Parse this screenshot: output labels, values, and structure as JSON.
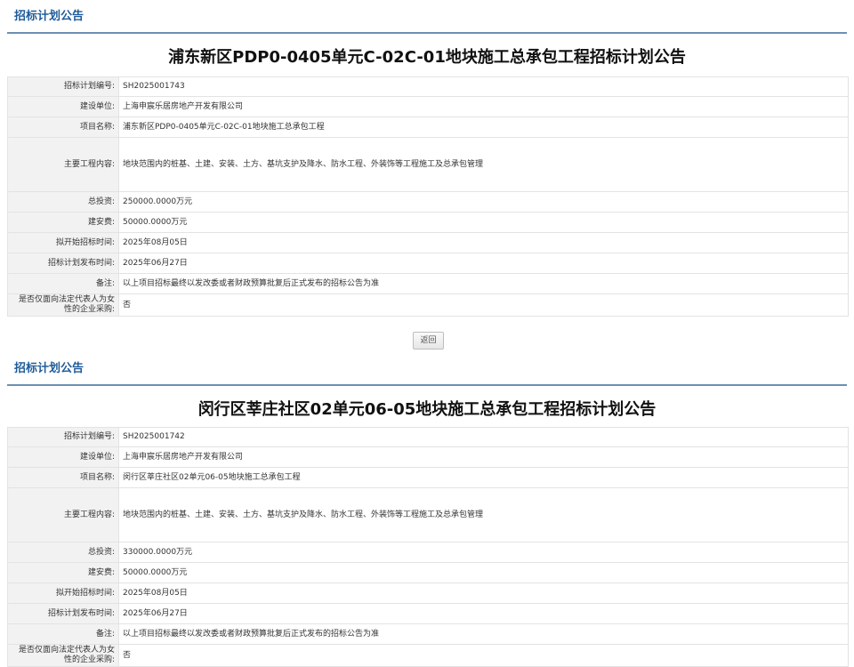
{
  "notices": [
    {
      "section_title": "招标计划公告",
      "title": "浦东新区PDP0-0405单元C-02C-01地块施工总承包工程招标计划公告",
      "rows": [
        {
          "label": "招标计划编号:",
          "value": "SH2025001743"
        },
        {
          "label": "建设单位:",
          "value": "上海申宸乐居房地产开发有限公司"
        },
        {
          "label": "项目名称:",
          "value": "浦东新区PDP0-0405单元C-02C-01地块施工总承包工程"
        },
        {
          "label": "主要工程内容:",
          "value": "地块范围内的桩基、土建、安装、土方、基坑支护及降水、防水工程、外装饰等工程施工及总承包管理"
        },
        {
          "label": "总投资:",
          "value": "250000.0000万元"
        },
        {
          "label": "建安费:",
          "value": "50000.0000万元"
        },
        {
          "label": "拟开始招标时间:",
          "value": "2025年08月05日"
        },
        {
          "label": "招标计划发布时间:",
          "value": "2025年06月27日"
        },
        {
          "label": "备注:",
          "value": "以上项目招标最终以发改委或者财政预算批复后正式发布的招标公告为准"
        },
        {
          "label": "是否仅面向法定代表人为女性的企业采购:",
          "value": "否"
        }
      ],
      "back_label": "返回"
    },
    {
      "section_title": "招标计划公告",
      "title": "闵行区莘庄社区02单元06-05地块施工总承包工程招标计划公告",
      "rows": [
        {
          "label": "招标计划编号:",
          "value": "SH2025001742"
        },
        {
          "label": "建设单位:",
          "value": "上海申宸乐居房地产开发有限公司"
        },
        {
          "label": "项目名称:",
          "value": "闵行区莘庄社区02单元06-05地块施工总承包工程"
        },
        {
          "label": "主要工程内容:",
          "value": "地块范围内的桩基、土建、安装、土方、基坑支护及降水、防水工程、外装饰等工程施工及总承包管理"
        },
        {
          "label": "总投资:",
          "value": "330000.0000万元"
        },
        {
          "label": "建安费:",
          "value": "50000.0000万元"
        },
        {
          "label": "拟开始招标时间:",
          "value": "2025年08月05日"
        },
        {
          "label": "招标计划发布时间:",
          "value": "2025年06月27日"
        },
        {
          "label": "备注:",
          "value": "以上项目招标最终以发改委或者财政预算批复后正式发布的招标公告为准"
        },
        {
          "label": "是否仅面向法定代表人为女性的企业采购:",
          "value": "否"
        }
      ]
    }
  ]
}
